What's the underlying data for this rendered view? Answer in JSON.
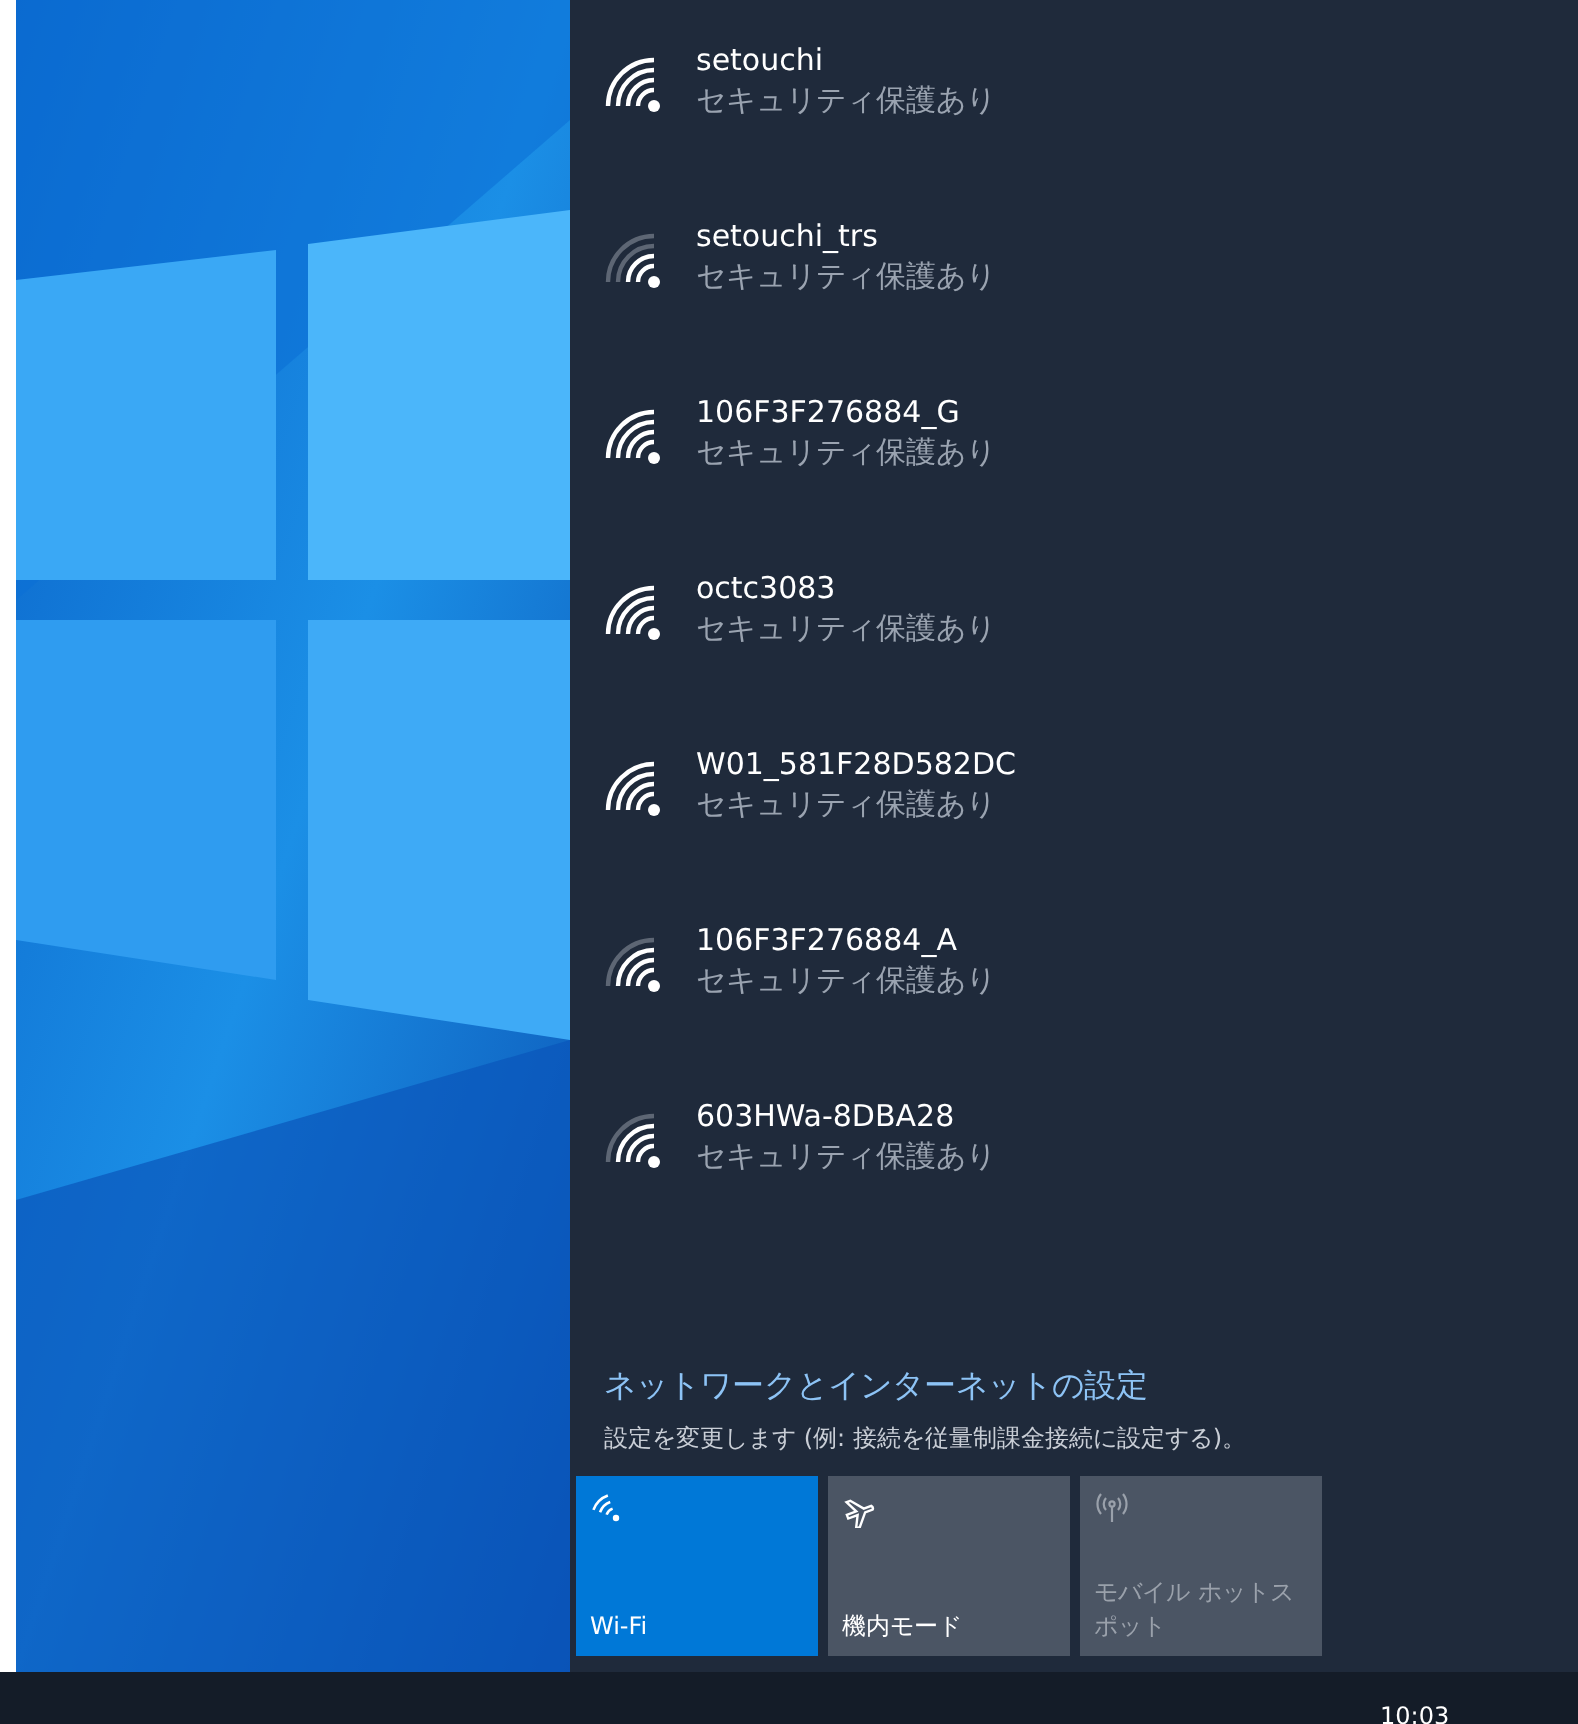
{
  "networks": [
    {
      "name": "setouchi",
      "status": "セキュリティ保護あり",
      "kind": "strong"
    },
    {
      "name": "setouchi_trs",
      "status": "セキュリティ保護あり",
      "kind": "weak"
    },
    {
      "name": "106F3F276884_G",
      "status": "セキュリティ保護あり",
      "kind": "strong"
    },
    {
      "name": "octc3083",
      "status": "セキュリティ保護あり",
      "kind": "strong"
    },
    {
      "name": "W01_581F28D582DC",
      "status": "セキュリティ保護あり",
      "kind": "strong"
    },
    {
      "name": "106F3F276884_A",
      "status": "セキュリティ保護あり",
      "kind": "fair"
    },
    {
      "name": "603HWa-8DBA28",
      "status": "セキュリティ保護あり",
      "kind": "fair"
    }
  ],
  "settings": {
    "link": "ネットワークとインターネットの設定",
    "description": "設定を変更します (例: 接続を従量制課金接続に設定する)。"
  },
  "tiles": [
    {
      "kind": "wifi",
      "label": "Wi-Fi",
      "on": true,
      "disabled": false
    },
    {
      "kind": "airplane",
      "label": "機内モード",
      "on": false,
      "disabled": false
    },
    {
      "kind": "hotspot",
      "label": "モバイル ホットスポット",
      "on": false,
      "disabled": true
    }
  ],
  "taskbar": {
    "clock": "10:03"
  }
}
